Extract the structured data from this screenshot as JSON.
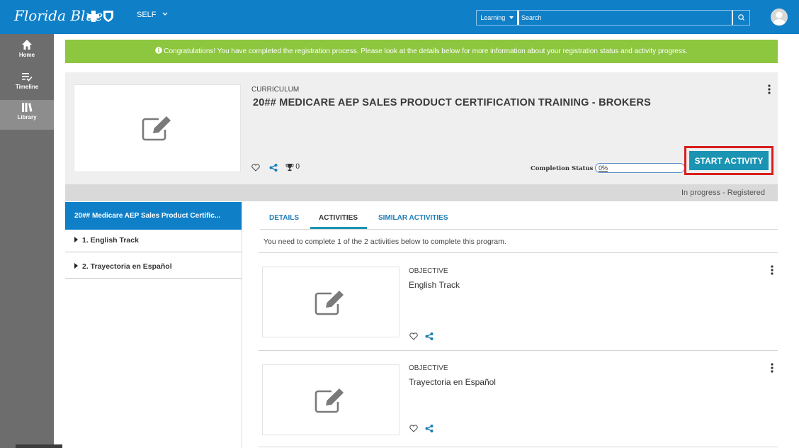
{
  "header": {
    "logo_text": "Florida Blue",
    "self_label": "SELF",
    "learning_label": "Learning",
    "search_placeholder": "Search"
  },
  "nav": {
    "items": [
      {
        "label": "Home"
      },
      {
        "label": "Timeline"
      },
      {
        "label": "Library"
      }
    ]
  },
  "banner": {
    "text": "Congratulations! You have completed the registration process. Please look at the details below for more information about your registration status and activity progress."
  },
  "curriculum": {
    "type": "CURRICULUM",
    "title": "20## MEDICARE AEP SALES PRODUCT CERTIFICATION TRAINING - BROKERS",
    "trophy_count": "0",
    "completion_label": "Completion Status",
    "progress_text": "0%",
    "progress_fraction": 0,
    "start_label": "START ACTIVITY",
    "status_text": "In progress - Registered"
  },
  "sidebar": {
    "active": "20## Medicare AEP Sales Product Certific...",
    "items": [
      {
        "label": "1. English Track"
      },
      {
        "label": "2. Trayectoria en Español"
      }
    ]
  },
  "tabs": {
    "items": [
      {
        "label": "DETAILS"
      },
      {
        "label": "ACTIVITIES"
      },
      {
        "label": "SIMILAR ACTIVITIES"
      }
    ],
    "active_index": 1
  },
  "activities": {
    "intro": "You need to complete 1 of the 2 activities below to complete this program.",
    "items": [
      {
        "type": "OBJECTIVE",
        "title": "English Track"
      },
      {
        "type": "OBJECTIVE",
        "title": "Trayectoria en Español"
      }
    ]
  },
  "colors": {
    "header_blue": "#0f7fc8",
    "nav_gray": "#6d6d6d",
    "banner_green": "#8dc63f",
    "start_button": "#1b94b3",
    "highlight_red": "#d81e1e"
  }
}
